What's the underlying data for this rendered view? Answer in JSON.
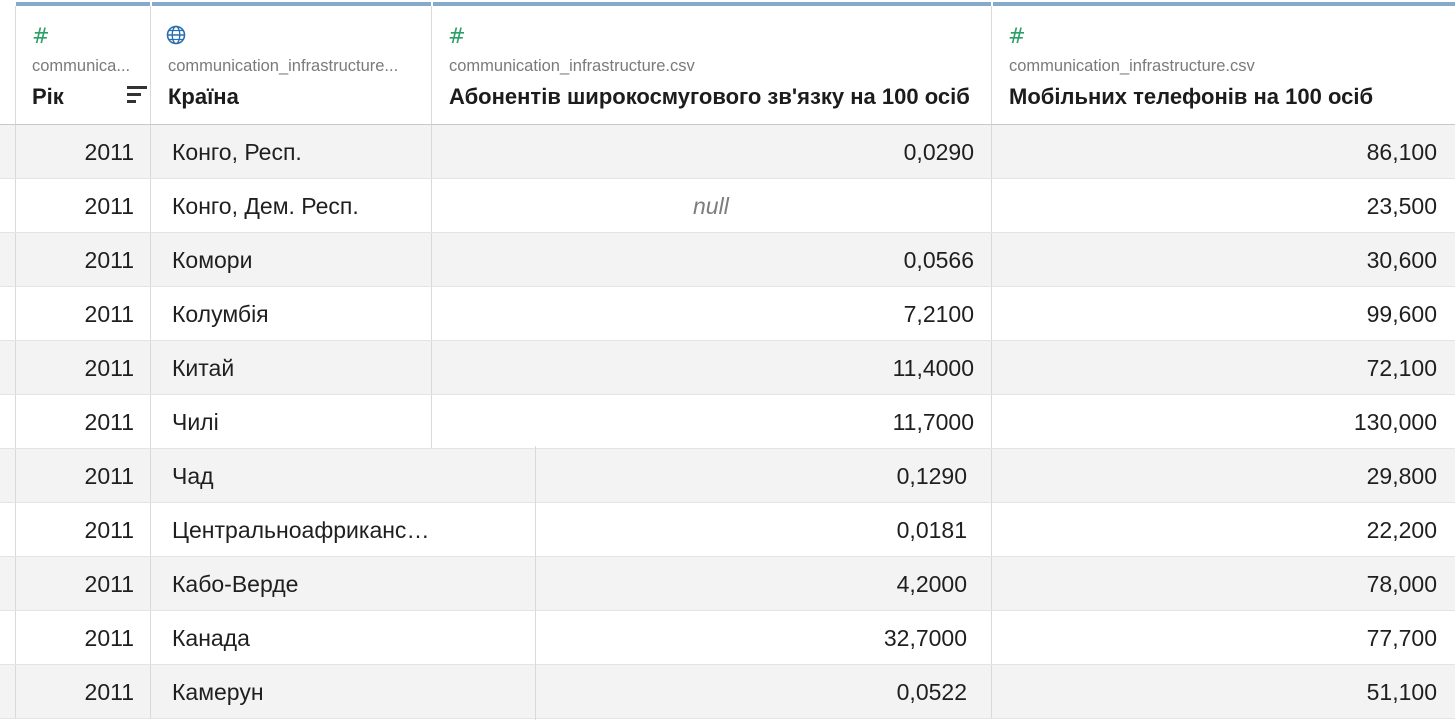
{
  "columns": [
    {
      "type_icon": "#",
      "source": "communica...",
      "title": "Рік"
    },
    {
      "type_icon": "globe",
      "source": "communication_infrastructure...",
      "title": "Країна"
    },
    {
      "type_icon": "#",
      "source": "communication_infrastructure.csv",
      "title": "Абонентів широкосмугового зв'язку на 100 осіб"
    },
    {
      "type_icon": "#",
      "source": "communication_infrastructure.csv",
      "title": "Мобільних телефонів на 100 осіб"
    }
  ],
  "rows": [
    {
      "year": "2011",
      "country": "Конго, Респ.",
      "broadband": "0,0290",
      "mobile": "86,100"
    },
    {
      "year": "2011",
      "country": "Конго, Дем. Респ.",
      "broadband": "null",
      "mobile": "23,500"
    },
    {
      "year": "2011",
      "country": "Комори",
      "broadband": "0,0566",
      "mobile": "30,600"
    },
    {
      "year": "2011",
      "country": "Колумбія",
      "broadband": "7,2100",
      "mobile": "99,600"
    },
    {
      "year": "2011",
      "country": "Китай",
      "broadband": "11,4000",
      "mobile": "72,100"
    },
    {
      "year": "2011",
      "country": "Чилі",
      "broadband": "11,7000",
      "mobile": "130,000"
    },
    {
      "year": "2011",
      "country": "Чад",
      "broadband": "0,1290",
      "mobile": "29,800"
    },
    {
      "year": "2011",
      "country": "Центральноафриканська Респ...",
      "broadband": "0,0181",
      "mobile": "22,200"
    },
    {
      "year": "2011",
      "country": "Кабо-Верде",
      "broadband": "4,2000",
      "mobile": "78,000"
    },
    {
      "year": "2011",
      "country": "Канада",
      "broadband": "32,7000",
      "mobile": "77,700"
    },
    {
      "year": "2011",
      "country": "Камерун",
      "broadband": "0,0522",
      "mobile": "51,100"
    }
  ],
  "colors": {
    "number_icon": "#2e9e6a",
    "globe_icon": "#2a6fb0",
    "header_bar": "#86aacb",
    "row_stripe": "#f3f3f3"
  }
}
